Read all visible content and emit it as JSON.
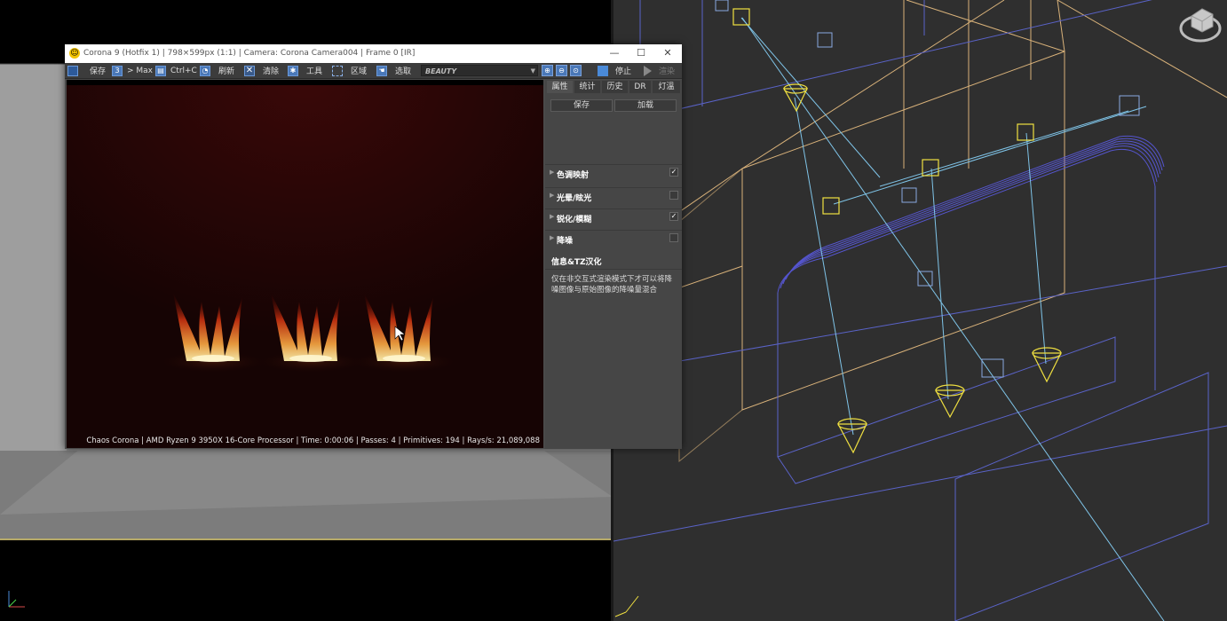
{
  "window": {
    "title": "Corona 9 (Hotfix 1) | 798×599px (1:1) | Camera: Corona Camera004 | Frame 0 [IR]",
    "minimize": "—",
    "maximize": "☐",
    "close": "✕"
  },
  "toolbar": {
    "save": "保存",
    "to_max": "> Max",
    "copy": "Ctrl+C",
    "refresh": "刷新",
    "clear": "清除",
    "tools": "工具",
    "region": "区域",
    "pick": "选取",
    "channel": "BEAUTY",
    "stop": "停止",
    "render": "渲染"
  },
  "panel": {
    "tabs": [
      "属性",
      "统计",
      "历史",
      "DR",
      "灯溫"
    ],
    "save_button": "保存",
    "load_button": "加载",
    "sections": [
      {
        "label": "色调映射",
        "checked": "✓"
      },
      {
        "label": "光晕/眩光",
        "checked": ""
      },
      {
        "label": "锐化/模糊",
        "checked": "✓"
      },
      {
        "label": "降噪",
        "checked": ""
      }
    ],
    "info_title": "信息&TZ汉化",
    "info_text": "仅在非交互式渲染模式下才可以将降噪图像与原始图像的降噪量混合"
  },
  "status": "Chaos Corona | AMD Ryzen 9 3950X 16-Core Processor  | Time: 0:00:06 | Passes: 4 | Primitives: 194 | Rays/s: 21,089,088",
  "colors": {
    "accent": "#4a78b8",
    "render_bg": "#1a0505",
    "viewport_bg": "#2f2f2f"
  }
}
